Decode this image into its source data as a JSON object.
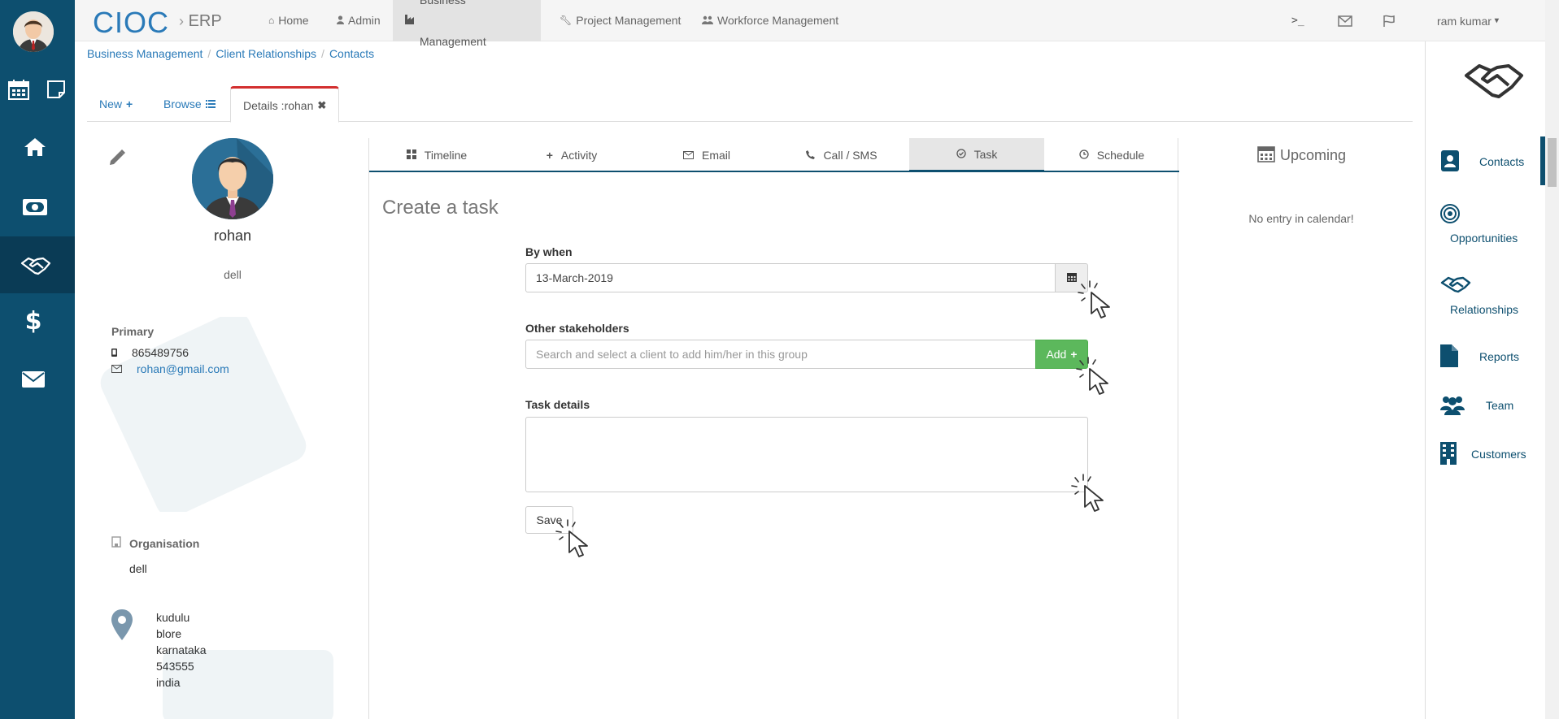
{
  "app": {
    "brand": "CIOC",
    "brand_sub": "ERP",
    "user_name": "ram kumar"
  },
  "topnav": {
    "items": [
      {
        "label": "Home",
        "icon": "home-icon"
      },
      {
        "label": "Admin",
        "icon": "user-icon"
      },
      {
        "label": "Business Management",
        "icon": "industry-icon",
        "active": true
      },
      {
        "label": "Project Management",
        "icon": "wrench-icon"
      },
      {
        "label": "Workforce Management",
        "icon": "users-icon"
      }
    ],
    "right_icons": [
      "terminal-icon",
      "envelope-icon",
      "flag-icon"
    ]
  },
  "breadcrumb": [
    "Business Management",
    "Client Relationships",
    "Contacts"
  ],
  "tabs": {
    "new_label": "New",
    "browse_label": "Browse",
    "details_label": "Details :rohan"
  },
  "profile": {
    "name": "rohan",
    "company": "dell",
    "primary_label": "Primary",
    "phone": "865489756",
    "email": "rohan@gmail.com",
    "organisation_label": "Organisation",
    "organisation": "dell",
    "address": [
      "kudulu",
      "blore",
      "karnataka",
      "543555",
      "india"
    ]
  },
  "center_tabs": [
    {
      "label": "Timeline",
      "icon": "th-large-icon"
    },
    {
      "label": "Activity",
      "icon": "plus-icon"
    },
    {
      "label": "Email",
      "icon": "envelope-icon"
    },
    {
      "label": "Call / SMS",
      "icon": "phone-icon"
    },
    {
      "label": "Task",
      "icon": "check-circle-icon",
      "active": true
    },
    {
      "label": "Schedule",
      "icon": "clock-icon"
    }
  ],
  "task_form": {
    "title": "Create a task",
    "by_when_label": "By when",
    "by_when_value": "13-March-2019",
    "stakeholders_label": "Other stakeholders",
    "stakeholders_placeholder": "Search and select a client to add him/her in this group",
    "add_label": "Add",
    "details_label": "Task details",
    "save_label": "Save"
  },
  "upcoming": {
    "title": "Upcoming",
    "empty_text": "No entry in calendar!"
  },
  "rightnav": {
    "items": [
      {
        "label": "Contacts",
        "icon": "contact-book-icon",
        "active": true
      },
      {
        "label": "Opportunities",
        "icon": "target-icon"
      },
      {
        "label": "Relationships",
        "icon": "handshake-icon"
      },
      {
        "label": "Reports",
        "icon": "file-icon"
      },
      {
        "label": "Team",
        "icon": "users-icon"
      },
      {
        "label": "Customers",
        "icon": "building-icon"
      }
    ]
  },
  "colors": {
    "sidebar": "#0d4f6f",
    "link": "#2a7ab8",
    "add_button": "#5cb85c",
    "active_tab_accent": "#d32f2f"
  }
}
